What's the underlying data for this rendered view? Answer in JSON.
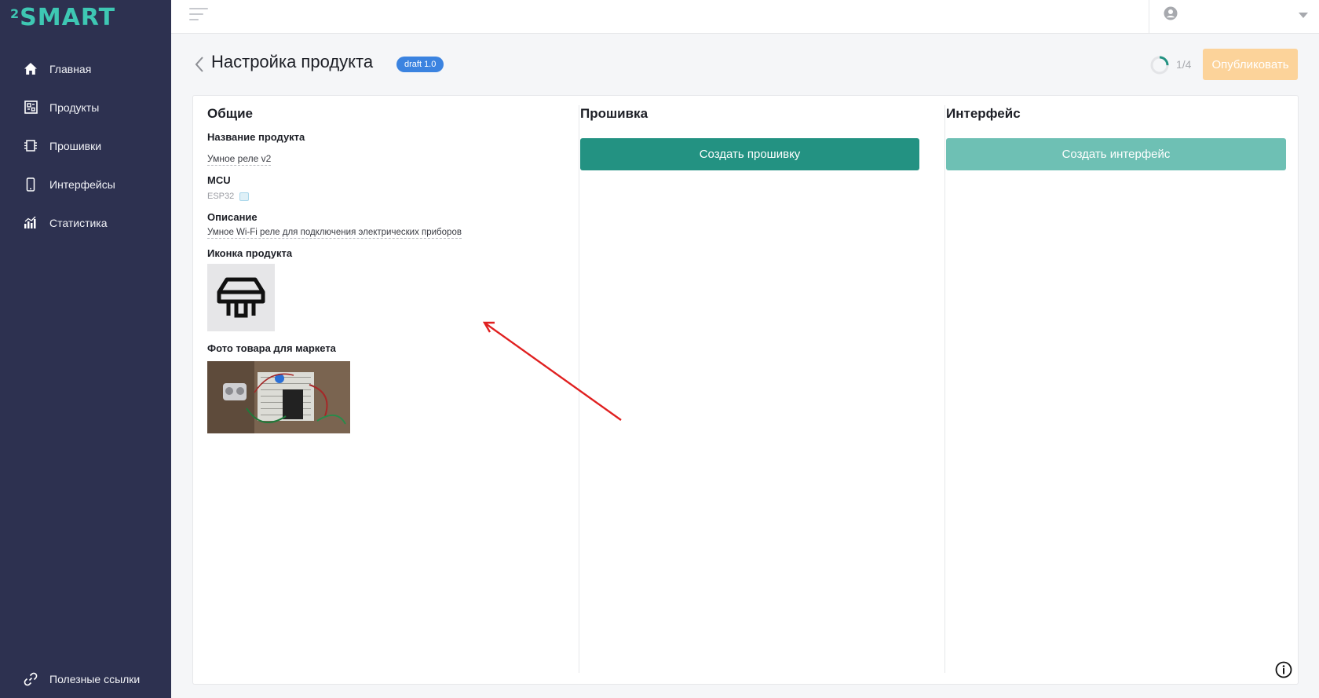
{
  "app": {
    "logo_sup": "2",
    "logo_word": "SMART"
  },
  "sidebar": {
    "items": [
      {
        "label": "Главная",
        "icon": "home-icon"
      },
      {
        "label": "Продукты",
        "icon": "products-icon"
      },
      {
        "label": "Прошивки",
        "icon": "chip-icon"
      },
      {
        "label": "Интерфейсы",
        "icon": "phone-icon"
      },
      {
        "label": "Статистика",
        "icon": "stats-icon"
      }
    ],
    "bottom": {
      "label": "Полезные ссылки",
      "icon": "link-icon"
    }
  },
  "header": {
    "title": "Настройка продукта",
    "badge": "draft 1.0",
    "step": "1/4",
    "step_progress": 0.25,
    "publish_label": "Опубликовать"
  },
  "general": {
    "title": "Общие",
    "name_label": "Название продукта",
    "name_value": "Умное реле v2",
    "mcu_label": "MCU",
    "mcu_value": "ESP32",
    "description_label": "Описание",
    "description_value": "Умное Wi-Fi реле для подключения электрических приборов",
    "icon_label": "Иконка продукта",
    "photo_label": "Фото товара для маркета"
  },
  "firmware": {
    "title": "Прошивка",
    "button": "Создать прошивку"
  },
  "interface": {
    "title": "Интерфейс",
    "button": "Создать интерфейс"
  },
  "colors": {
    "sidebar": "#2d3150",
    "accent": "#239282",
    "accent_light": "#6ec0b4",
    "publish": "#fcd39a",
    "badge": "#3b83e0",
    "annotation": "#e02020"
  }
}
